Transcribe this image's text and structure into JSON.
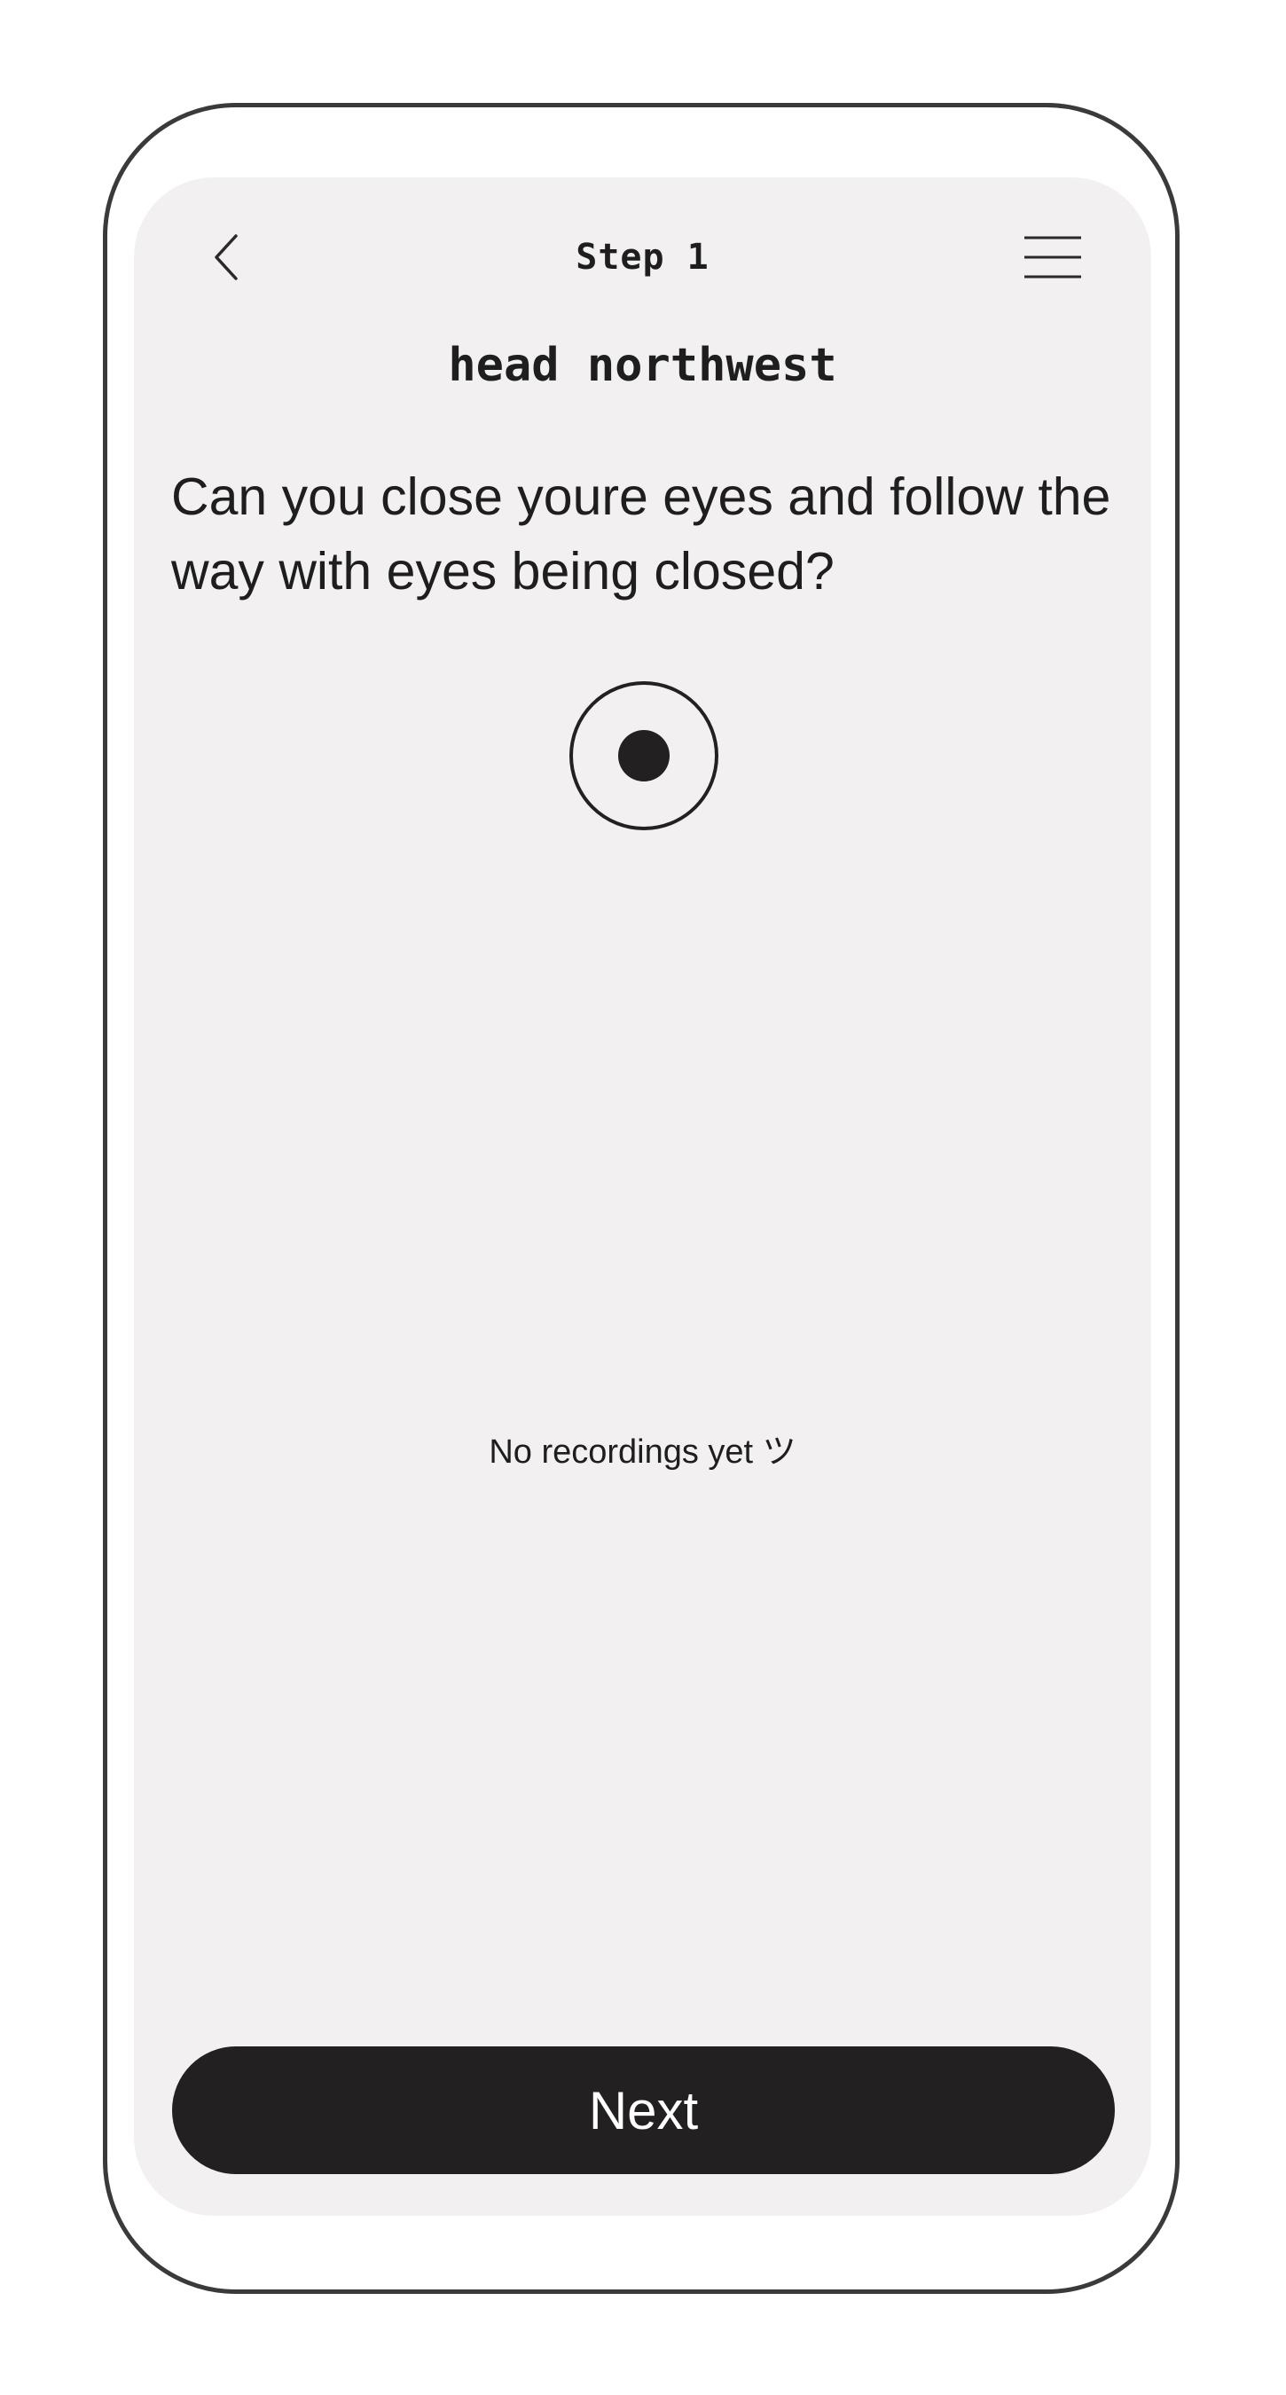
{
  "header": {
    "title": "Step 1",
    "back_icon": "chevron-left-icon",
    "menu_icon": "hamburger-menu-icon"
  },
  "main": {
    "direction": "head northwest",
    "question": "Can you close youre eyes and follow the way with eyes being closed?",
    "record_icon": "record-icon",
    "empty_state": "No recordings yet ツ"
  },
  "footer": {
    "next_label": "Next"
  },
  "colors": {
    "frame_border": "#3a3a3a",
    "screen_background": "#f2f0f1",
    "text": "#1e1e1e",
    "button_background": "#222021",
    "button_text": "#ffffff"
  }
}
